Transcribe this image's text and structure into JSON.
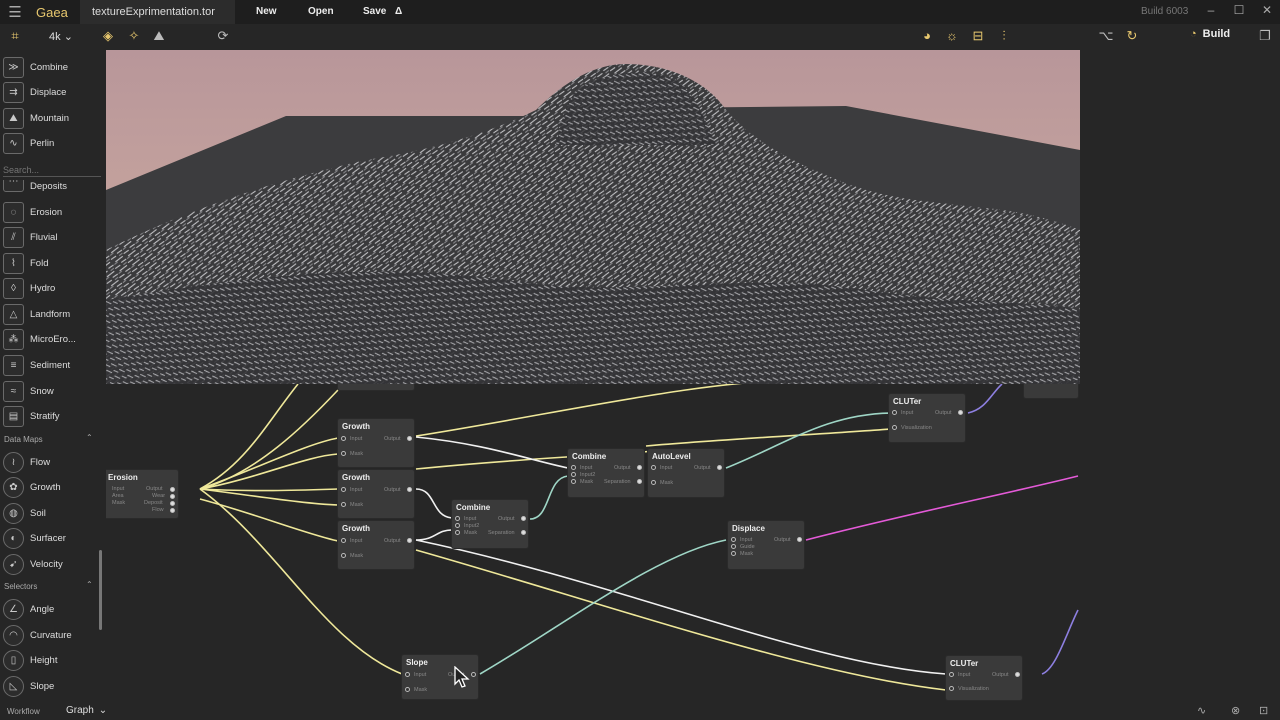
{
  "titlebar": {
    "app_name": "Gaea",
    "file_name": "textureExprimentation.tor",
    "menu": [
      "New",
      "Open",
      "Save"
    ],
    "delta_icon": "Δ",
    "build_number": "Build 6003"
  },
  "toolbar": {
    "resolution": "4k",
    "build_label": "Build"
  },
  "sidebar": {
    "pinned": [
      "Combine",
      "Displace",
      "Mountain",
      "Perlin"
    ],
    "search_placeholder": "Search...",
    "erosion_nodes": [
      "Deposits",
      "Erosion",
      "Fluvial",
      "Fold",
      "Hydro",
      "Landform",
      "MicroEro...",
      "Sediment",
      "Snow",
      "Stratify"
    ],
    "data_maps_label": "Data Maps",
    "data_maps": [
      "Flow",
      "Growth",
      "Soil",
      "Surfacer",
      "Velocity"
    ],
    "selectors_label": "Selectors",
    "selectors": [
      "Angle",
      "Curvature",
      "Height",
      "Slope"
    ],
    "workflow_label": "Workflow",
    "workflow_value": "Graph"
  },
  "graph": {
    "nodes": {
      "erosion": {
        "title": "Erosion",
        "inputs": [
          "Input",
          "Area",
          "Mask"
        ],
        "outputs": [
          "Output",
          "Wear",
          "Deposit",
          "Flow"
        ]
      },
      "growth1": {
        "title": "Growth",
        "inputs": [
          "Input",
          "Mask"
        ],
        "outputs": [
          "Output"
        ]
      },
      "growth2": {
        "title": "Growth",
        "inputs": [
          "Input",
          "Mask"
        ],
        "outputs": [
          "Output"
        ]
      },
      "growth3": {
        "title": "Growth",
        "inputs": [
          "Input",
          "Mask"
        ],
        "outputs": [
          "Output"
        ]
      },
      "combine1": {
        "title": "Combine",
        "inputs": [
          "Input",
          "Input2",
          "Mask"
        ],
        "outputs": [
          "Output",
          "Separation"
        ]
      },
      "combine2": {
        "title": "Combine",
        "inputs": [
          "Input",
          "Input2",
          "Mask"
        ],
        "outputs": [
          "Output",
          "Separation"
        ]
      },
      "autolevel": {
        "title": "AutoLevel",
        "inputs": [
          "Input",
          "Mask"
        ],
        "outputs": [
          "Output"
        ]
      },
      "clutter1": {
        "title": "CLUTer",
        "inputs": [
          "Input",
          "Visualization"
        ],
        "outputs": [
          "Output"
        ]
      },
      "displace": {
        "title": "Displace",
        "inputs": [
          "Input",
          "Guide",
          "Mask"
        ],
        "outputs": [
          "Output"
        ]
      },
      "slope": {
        "title": "Slope",
        "inputs": [
          "Input",
          "Mask"
        ],
        "outputs": [
          "Output"
        ]
      },
      "clutter2": {
        "title": "CLUTer",
        "inputs": [
          "Input",
          "Visualization"
        ],
        "outputs": [
          "Output"
        ]
      }
    }
  }
}
